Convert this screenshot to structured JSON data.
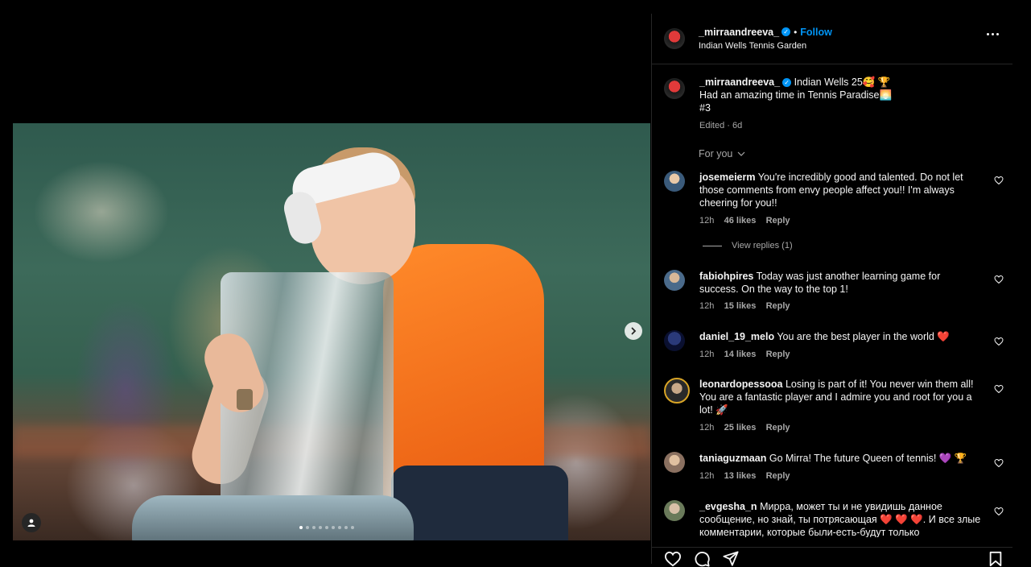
{
  "post": {
    "username": "_mirraandreeva_",
    "location": "Indian Wells Tennis Garden",
    "follow_label": "Follow",
    "separator": "•",
    "caption_lines": [
      "Indian Wells 25🥰 🏆",
      "Had an amazing time in Tennis Paradise🌅",
      "#3"
    ],
    "edited": "Edited · 6d",
    "carousel_total": 9,
    "carousel_active": 1
  },
  "comments_filter": "For you",
  "comments": [
    {
      "user": "josemeierm",
      "text": "You're incredibly good and talented. Do not let those comments from envy people affect you!! I'm always cheering for you!!",
      "time": "12h",
      "likes": "46 likes",
      "reply": "Reply",
      "view_replies": "View replies (1)"
    },
    {
      "user": "fabiohpires",
      "text": "Today was just another learning game for success. On the way to the top 1!",
      "time": "12h",
      "likes": "15 likes",
      "reply": "Reply"
    },
    {
      "user": "daniel_19_melo",
      "text": "You are the best player in the world ❤️",
      "time": "12h",
      "likes": "14 likes",
      "reply": "Reply"
    },
    {
      "user": "leonardopessooa",
      "text": "Losing is part of it! You never win them all! You are a fantastic player and I admire you and root for you a lot! 🚀",
      "time": "12h",
      "likes": "25 likes",
      "reply": "Reply"
    },
    {
      "user": "taniaguzmaan",
      "text": "Go Mirra! The future Queen of tennis! 💜 🏆",
      "time": "12h",
      "likes": "13 likes",
      "reply": "Reply"
    },
    {
      "user": "_evgesha_n",
      "text": "Мирра, может ты и не увидишь данное сообщение, но знай, ты потрясающая ❤️ ❤️ ❤️. И все злые комментарии, которые были-есть-будут только",
      "time": "",
      "likes": "",
      "reply": ""
    }
  ],
  "colors": {
    "accent": "#0095f6",
    "background": "#000000",
    "muted": "#a8a8a8"
  },
  "icons": [
    "more-icon",
    "heart-icon",
    "comment-icon",
    "share-icon",
    "bookmark-icon",
    "chevron-right-icon",
    "user-tag-icon",
    "chevron-down-icon",
    "verified-icon"
  ]
}
